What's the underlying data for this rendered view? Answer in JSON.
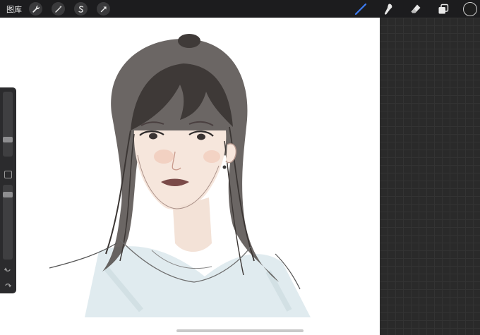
{
  "topbar": {
    "gallery_label": "图库",
    "left_tools": [
      "wrench-icon",
      "magic-wand-icon",
      "selection-icon",
      "transform-arrow-icon"
    ],
    "right_tools": [
      "brush-icon",
      "smudge-icon",
      "eraser-icon",
      "layers-icon"
    ],
    "active_tool": "brush-icon",
    "brush_active_color": "#3d7cf5",
    "current_color": "#1e1e1e"
  },
  "sidebar": {
    "brush_size_level": 0.36,
    "opacity_level": 0.1
  },
  "canvas": {
    "background": "#ffffff",
    "artwork": "portrait-sketch"
  }
}
